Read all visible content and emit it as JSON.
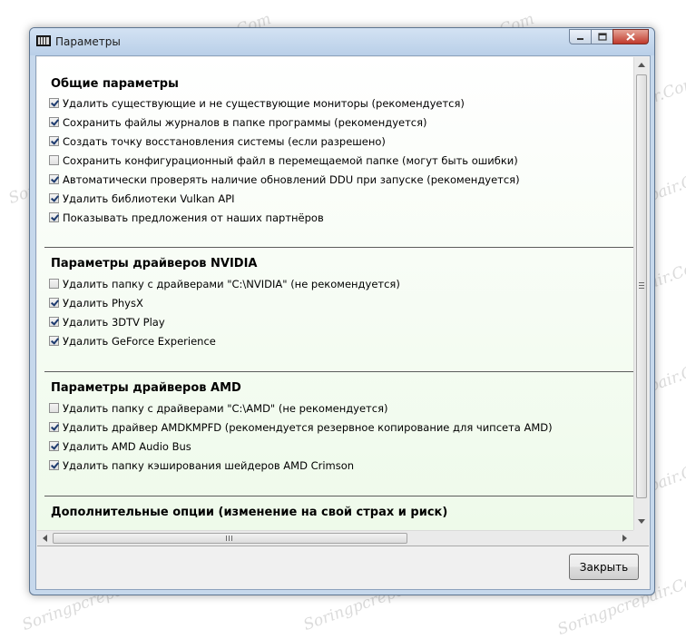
{
  "window": {
    "title": "Параметры"
  },
  "sections": {
    "general": {
      "title": "Общие параметры",
      "items": [
        {
          "label": "Удалить существующие и не существующие мониторы (рекомендуется)",
          "checked": true
        },
        {
          "label": "Сохранить файлы журналов в папке программы (рекомендуется)",
          "checked": true
        },
        {
          "label": "Создать точку восстановления системы (если разрешено)",
          "checked": true
        },
        {
          "label": "Сохранить конфигурационный файл в перемещаемой папке (могут быть ошибки)",
          "checked": false
        },
        {
          "label": "Автоматически проверять наличие обновлений DDU при запуске (рекомендуется)",
          "checked": true
        },
        {
          "label": "Удалить библиотеки Vulkan API",
          "checked": true
        },
        {
          "label": "Показывать предложения от наших партнёров",
          "checked": true
        }
      ]
    },
    "nvidia": {
      "title": "Параметры драйверов NVIDIA",
      "items": [
        {
          "label": "Удалить папку с драйверами \"C:\\NVIDIA\" (не рекомендуется)",
          "checked": false
        },
        {
          "label": "Удалить PhysX",
          "checked": true
        },
        {
          "label": "Удалить 3DTV Play",
          "checked": true
        },
        {
          "label": "Удалить GeForce Experience",
          "checked": true
        }
      ]
    },
    "amd": {
      "title": "Параметры драйверов AMD",
      "items": [
        {
          "label": "Удалить папку с драйверами \"C:\\AMD\" (не рекомендуется)",
          "checked": false
        },
        {
          "label": "Удалить драйвер AMDKMPFD (рекомендуется резервное копирование для чипсета AMD)",
          "checked": true
        },
        {
          "label": "Удалить AMD Audio Bus",
          "checked": true
        },
        {
          "label": "Удалить папку кэширования шейдеров AMD Crimson",
          "checked": true
        }
      ]
    },
    "advanced": {
      "title": "Дополнительные опции (изменение на свой страх и риск)"
    }
  },
  "buttons": {
    "close_label": "Закрыть"
  },
  "watermark": "Soringpcrepair.Com"
}
